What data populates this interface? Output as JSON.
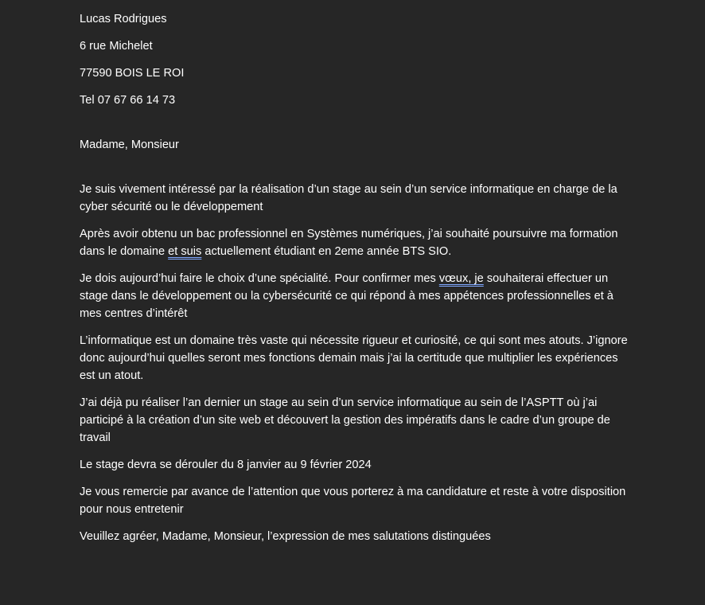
{
  "letter": {
    "sender_name": "Lucas Rodrigues",
    "street": "6 rue Michelet",
    "city": "77590 BOIS LE ROI",
    "phone": "Tel 07 67 66 14 73",
    "salutation": "Madame, Monsieur",
    "p1": "Je suis vivement intéressé par la réalisation d’un stage au sein d’un service informatique en charge de la cyber sécurité ou le développement",
    "p2_before": "Après avoir obtenu un bac professionnel en Systèmes numériques, j’ai souhaité poursuivre ma formation dans le domaine ",
    "p2_flag": "et  suis",
    "p2_after": " actuellement étudiant en 2eme année BTS SIO.",
    "p3_before": "Je dois aujourd’hui faire le choix d’une spécialité. Pour confirmer mes ",
    "p3_flag": "vœux,  je",
    "p3_after": " souhaiterai effectuer un stage dans le développement ou la cybersécurité ce qui répond à mes appétences professionnelles et à mes centres d’intérêt",
    "p4": "L’informatique est un domaine très vaste qui nécessite rigueur et curiosité, ce qui sont mes atouts. J’ignore donc aujourd’hui quelles seront mes fonctions demain mais j’ai la certitude que multiplier les expériences est un atout.",
    "p5": "J’ai déjà pu réaliser l’an dernier un stage au sein d’un service informatique au sein de l’ASPTT où j’ai participé à la création d’un site web et découvert la gestion des impératifs dans le cadre d’un groupe de travail",
    "p6": "Le stage devra se dérouler du 8 janvier au 9 février 2024",
    "p7": "Je vous remercie par avance de l’attention que vous porterez à ma candidature et reste à votre disposition pour nous entretenir",
    "p8": "Veuillez agréer, Madame, Monsieur, l’expression de mes salutations distinguées"
  },
  "colors": {
    "background": "#262626",
    "text": "#ffffff",
    "grammar_underline": "#7fa8ff"
  }
}
